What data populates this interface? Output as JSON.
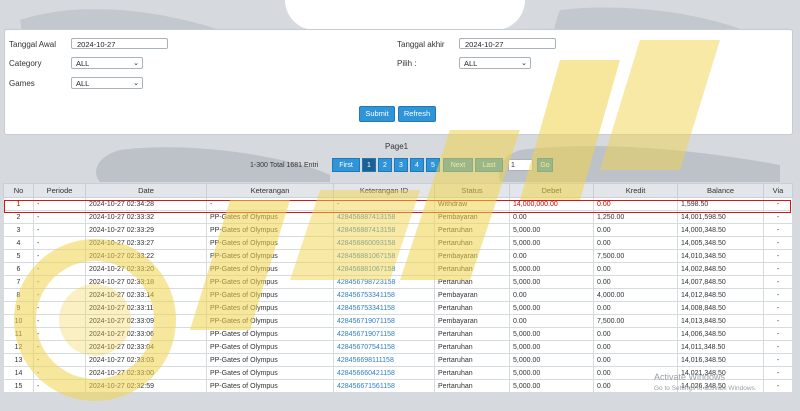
{
  "filters": {
    "tanggal_awal_label": "Tanggal Awal",
    "tanggal_awal_value": "2024-10-27",
    "tanggal_akhir_label": "Tanggal akhir",
    "tanggal_akhir_value": "2024-10-27",
    "category_label": "Category",
    "category_value": "ALL",
    "pilih_label": "Pilih  :",
    "pilih_value": "ALL",
    "games_label": "Games",
    "games_value": "ALL",
    "submit_label": "Submit",
    "refresh_label": "Refresh"
  },
  "pager": {
    "page_label": "Page1",
    "total_label": "1-300 Total 1681 Entri",
    "first": "First",
    "pages": [
      "1",
      "2",
      "3",
      "4",
      "5"
    ],
    "next": "Next",
    "last": "Last",
    "input_value": "1",
    "go": "Go"
  },
  "table": {
    "headers": [
      "No",
      "Periode",
      "Date",
      "Keterangan",
      "Keterangan ID",
      "Status",
      "Debet",
      "Kredit",
      "Balance",
      "Via"
    ],
    "rows": [
      [
        "1",
        "-",
        "2024-10-27 02:34:28",
        "-",
        "-",
        "Withdraw",
        "14,000,000.00",
        "0.00",
        "1,598.50",
        "-"
      ],
      [
        "2",
        "-",
        "2024-10-27 02:33:32",
        "PP-Gates of Olympus",
        "428456887413158",
        "Pembayaran",
        "0.00",
        "1,250.00",
        "14,001,598.50",
        "-"
      ],
      [
        "3",
        "-",
        "2024-10-27 02:33:29",
        "PP-Gates of Olympus",
        "428456887413158",
        "Pertaruhan",
        "5,000.00",
        "0.00",
        "14,000,348.50",
        "-"
      ],
      [
        "4",
        "-",
        "2024-10-27 02:33:27",
        "PP-Gates of Olympus",
        "428456860093158",
        "Pertaruhan",
        "5,000.00",
        "0.00",
        "14,005,348.50",
        "-"
      ],
      [
        "5",
        "-",
        "2024-10-27 02:33:22",
        "PP-Gates of Olympus",
        "428456881067158",
        "Pembayaran",
        "0.00",
        "7,500.00",
        "14,010,348.50",
        "-"
      ],
      [
        "6",
        "-",
        "2024-10-27 02:33:20",
        "PP-Gates of Olympus",
        "428456881067158",
        "Pertaruhan",
        "5,000.00",
        "0.00",
        "14,002,848.50",
        "-"
      ],
      [
        "7",
        "-",
        "2024-10-27 02:33:18",
        "PP-Gates of Olympus",
        "428456798723158",
        "Pertaruhan",
        "5,000.00",
        "0.00",
        "14,007,848.50",
        "-"
      ],
      [
        "8",
        "-",
        "2024-10-27 02:33:14",
        "PP-Gates of Olympus",
        "428456753341158",
        "Pembayaran",
        "0.00",
        "4,000.00",
        "14,012,848.50",
        "-"
      ],
      [
        "9",
        "-",
        "2024-10-27 02:33:11",
        "PP-Gates of Olympus",
        "428456753341158",
        "Pertaruhan",
        "5,000.00",
        "0.00",
        "14,008,848.50",
        "-"
      ],
      [
        "10",
        "-",
        "2024-10-27 02:33:09",
        "PP-Gates of Olympus",
        "428456719071158",
        "Pembayaran",
        "0.00",
        "7,500.00",
        "14,013,848.50",
        "-"
      ],
      [
        "11",
        "-",
        "2024-10-27 02:33:06",
        "PP-Gates of Olympus",
        "428456719071158",
        "Pertaruhan",
        "5,000.00",
        "0.00",
        "14,006,348.50",
        "-"
      ],
      [
        "12",
        "-",
        "2024-10-27 02:33:04",
        "PP-Gates of Olympus",
        "428456707541158",
        "Pertaruhan",
        "5,000.00",
        "0.00",
        "14,011,348.50",
        "-"
      ],
      [
        "13",
        "-",
        "2024-10-27 02:33:03",
        "PP-Gates of Olympus",
        "428456698111158",
        "Pertaruhan",
        "5,000.00",
        "0.00",
        "14,016,348.50",
        "-"
      ],
      [
        "14",
        "-",
        "2024-10-27 02:33:00",
        "PP-Gates of Olympus",
        "428456660421158",
        "Pertaruhan",
        "5,000.00",
        "0.00",
        "14,021,348.50",
        "-"
      ],
      [
        "15",
        "-",
        "2024-10-27 02:32:59",
        "PP-Gates of Olympus",
        "428456671561158",
        "Pertaruhan",
        "5,000.00",
        "0.00",
        "14,026,348.50",
        "-"
      ]
    ]
  },
  "watermark": {
    "text": "IDWIN",
    "color": "#f1d34c"
  },
  "windows_notice": {
    "title": "Activate Windows",
    "subtitle": "Go to Settings to activate Windows."
  },
  "colors": {
    "accent": "#2f95d6",
    "highlight": "#d01818",
    "link": "#2f7fc4"
  }
}
